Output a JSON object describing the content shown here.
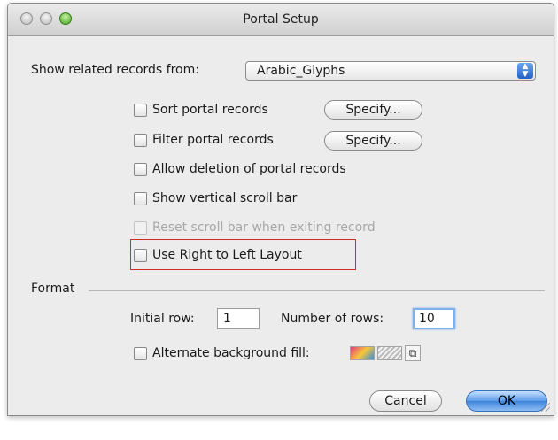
{
  "window": {
    "title": "Portal Setup"
  },
  "related": {
    "label": "Show related records from:",
    "value": "Arabic_Glyphs"
  },
  "options": {
    "sort": {
      "label": "Sort portal records",
      "button": "Specify..."
    },
    "filter": {
      "label": "Filter portal records",
      "button": "Specify..."
    },
    "allow_deletion": {
      "label": "Allow deletion of portal records"
    },
    "vertical_scroll": {
      "label": "Show vertical scroll bar"
    },
    "reset_scroll": {
      "label": "Reset scroll bar when exiting record"
    },
    "rtl_layout": {
      "label": "Use Right to Left Layout"
    }
  },
  "format": {
    "section_label": "Format",
    "initial_row_label": "Initial row:",
    "initial_row_value": "1",
    "num_rows_label": "Number of rows:",
    "num_rows_value": "10",
    "alt_fill_label": "Alternate background fill:"
  },
  "buttons": {
    "cancel": "Cancel",
    "ok": "OK"
  },
  "colors": {
    "highlight_box": "#d22b2b",
    "default_button": "#3f83dc"
  }
}
